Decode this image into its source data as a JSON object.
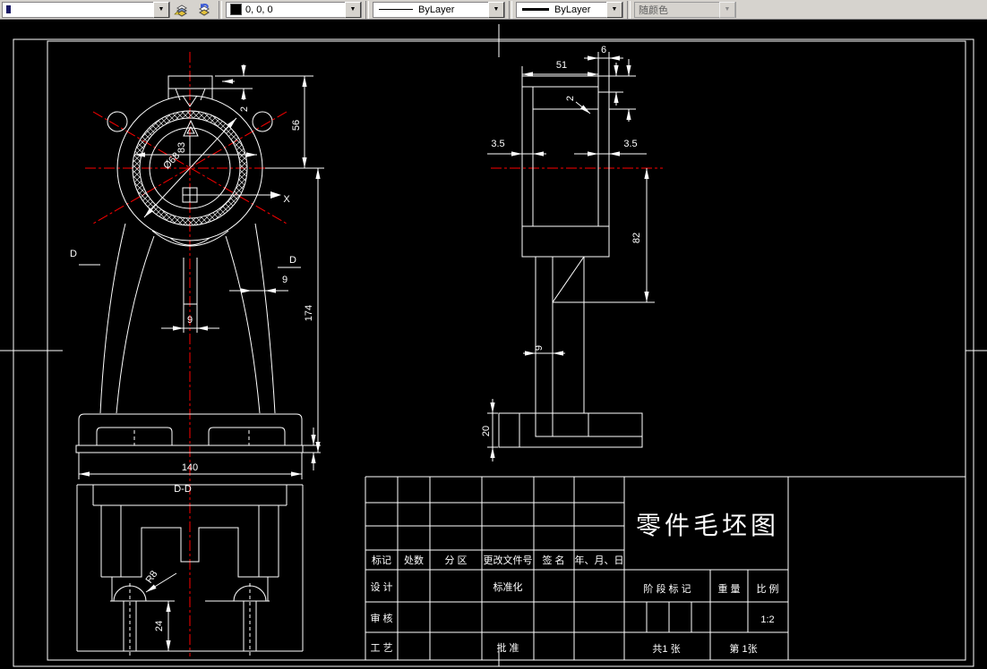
{
  "toolbar": {
    "layer_value": "",
    "icons": [
      "make-object-layer-current",
      "layer-previous"
    ],
    "color": {
      "value": "0, 0, 0",
      "swatch": "#000000"
    },
    "linetype": {
      "value": "ByLayer"
    },
    "lineweight": {
      "value": "ByLayer"
    },
    "plot_style": {
      "value": "随颜色"
    }
  },
  "drawing": {
    "front_view": {
      "dims": {
        "v56": "56",
        "v83": "83",
        "dia68": "Ø68",
        "v2": "2",
        "web9": "9",
        "leg9": "9",
        "v174": "174",
        "v140": "140",
        "r8": "R8",
        "v24": "24"
      },
      "labels": {
        "d_left": "D",
        "d_right": "D",
        "dd": "D-D",
        "x": "X"
      }
    },
    "side_view": {
      "dims": {
        "v51": "51",
        "v6": "6",
        "v2": "2",
        "left35": "3.5",
        "right35": "3.5",
        "v82": "82",
        "v9": "9",
        "v20": "20"
      }
    },
    "title_block": {
      "rev_headers": [
        "标记",
        "处数",
        "分 区",
        "更改文件号",
        "签 名",
        "年、月、日"
      ],
      "design": "设 计",
      "standardization": "标准化",
      "audit": "审 核",
      "process": "工 艺",
      "approve": "批 准",
      "title": "零件毛坯图",
      "stage_mark": "阶 段 标 记",
      "weight": "重 量",
      "scale": "比 例",
      "scale_value": "1:2",
      "sheets_total": "共1  张",
      "sheet_number": "第  1张"
    }
  },
  "colors": {
    "background": "#000000",
    "line": "#ffffff",
    "centerline": "#ff0000",
    "toolbar": "#d6d3ce"
  }
}
